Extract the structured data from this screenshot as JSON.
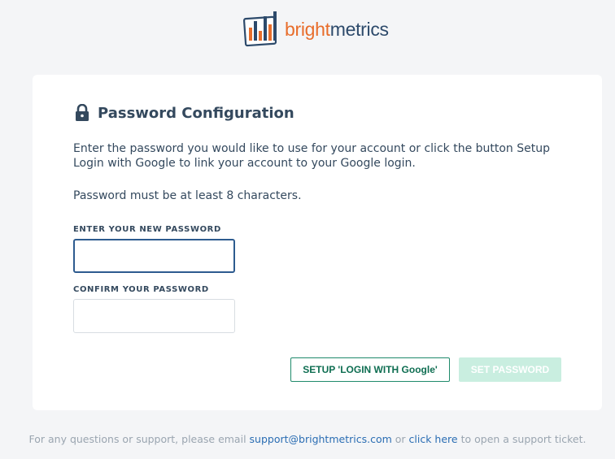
{
  "logo": {
    "part1": "bright",
    "part2": "metrics",
    "icon": "bar-chart-logo-icon",
    "colors": {
      "orange": "#e86d2b",
      "navy": "#2d4a6b"
    }
  },
  "card": {
    "title": "Password Configuration",
    "title_icon": "lock-icon",
    "description": "Enter the password you would like to use for your account or click the button Setup Login with Google to link your account to your Google login.",
    "requirement": "Password must be at least 8 characters.",
    "new_password": {
      "label": "ENTER YOUR NEW PASSWORD",
      "value": ""
    },
    "confirm_password": {
      "label": "CONFIRM YOUR PASSWORD",
      "value": ""
    },
    "google_button": "SETUP 'LOGIN WITH Google'",
    "set_password_button": "SET PASSWORD"
  },
  "footer": {
    "text1": "For any questions or support, please email",
    "email_link": "support@brightmetrics.com",
    "text2": "or",
    "ticket_link": "click here",
    "text3": "to open a support ticket."
  }
}
